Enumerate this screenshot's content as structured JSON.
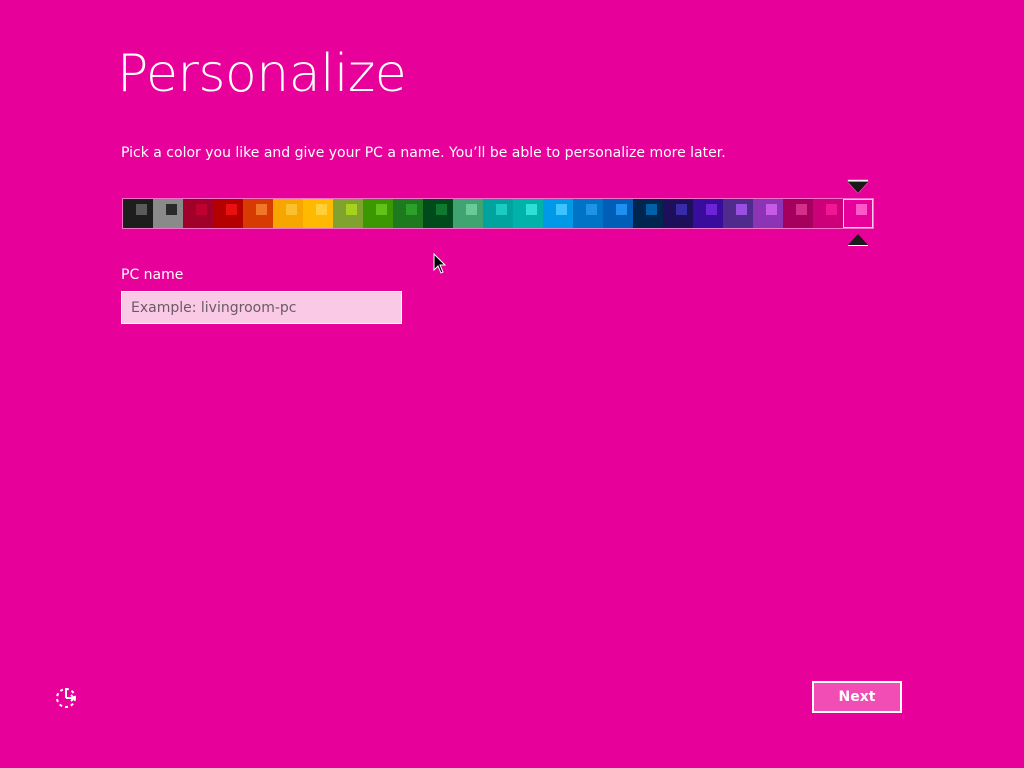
{
  "page": {
    "title": "Personalize",
    "subtitle": "Pick a color you like and give your PC a name. You’ll be able to personalize more later."
  },
  "colors": {
    "background": "#E8009A",
    "accent_button": "#F24DB5",
    "input_background": "#F9C9E6"
  },
  "palette": {
    "selected_index": 24,
    "swatches": [
      {
        "bg": "#1D1D1D",
        "inner": "#5A5A5A"
      },
      {
        "bg": "#8A8A8A",
        "inner": "#2A2A2A"
      },
      {
        "bg": "#A0002A",
        "inner": "#C00030"
      },
      {
        "bg": "#B50000",
        "inner": "#E81010"
      },
      {
        "bg": "#D83B01",
        "inner": "#F0772A"
      },
      {
        "bg": "#F7A600",
        "inner": "#FBC02D"
      },
      {
        "bg": "#FFB900",
        "inner": "#FFD03A"
      },
      {
        "bg": "#7FA32E",
        "inner": "#A8D01F"
      },
      {
        "bg": "#3B9800",
        "inner": "#63C216"
      },
      {
        "bg": "#1E7A1E",
        "inner": "#2BA02B"
      },
      {
        "bg": "#004B1C",
        "inner": "#0F7A2F"
      },
      {
        "bg": "#3FA372",
        "inner": "#6BCB98"
      },
      {
        "bg": "#00A39E",
        "inner": "#1CCBC4"
      },
      {
        "bg": "#00B2A9",
        "inner": "#2EE0D5"
      },
      {
        "bg": "#0099E8",
        "inner": "#3BC4FF"
      },
      {
        "bg": "#0073C6",
        "inner": "#1E94E8"
      },
      {
        "bg": "#005EB8",
        "inner": "#1E90F0"
      },
      {
        "bg": "#00264F",
        "inner": "#0060A8"
      },
      {
        "bg": "#1D0F5A",
        "inner": "#3A2BA8"
      },
      {
        "bg": "#3A0C9E",
        "inner": "#6B24D6"
      },
      {
        "bg": "#4F2B8E",
        "inner": "#9B4FE0"
      },
      {
        "bg": "#8D34B6",
        "inner": "#C65BE8"
      },
      {
        "bg": "#A6005F",
        "inner": "#D62E8B"
      },
      {
        "bg": "#CC0079",
        "inner": "#F01696"
      },
      {
        "bg": "#E8009A",
        "inner": "#FF58C8"
      }
    ]
  },
  "pc_name": {
    "label": "PC name",
    "placeholder": "Example: livingroom-pc",
    "value": ""
  },
  "footer": {
    "next_label": "Next",
    "ease_of_access_icon": "ease-of-access-icon"
  }
}
